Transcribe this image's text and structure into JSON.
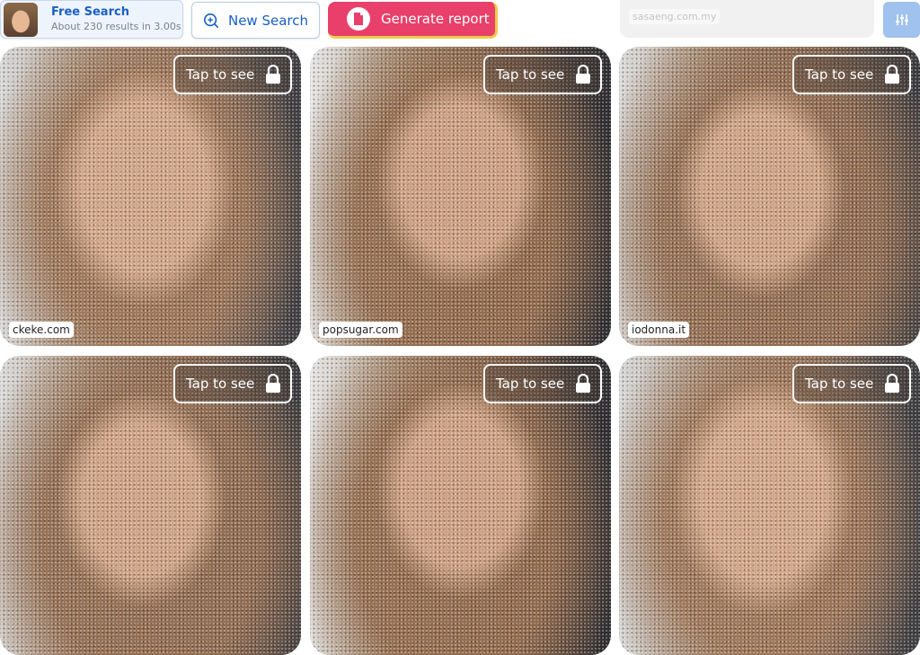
{
  "header": {
    "free_search_title": "Free Search",
    "free_search_subtitle": "About 230 results in 3.00s",
    "new_search_label": "New Search",
    "generate_report_label": "Generate report",
    "top_card_source": "sasaeng.com.my"
  },
  "results": [
    {
      "tap_label": "Tap to see",
      "source": "ckeke.com"
    },
    {
      "tap_label": "Tap to see",
      "source": "popsugar.com"
    },
    {
      "tap_label": "Tap to see",
      "source": "iodonna.it"
    },
    {
      "tap_label": "Tap to see",
      "source": ""
    },
    {
      "tap_label": "Tap to see",
      "source": ""
    },
    {
      "tap_label": "Tap to see",
      "source": ""
    }
  ],
  "colors": {
    "accent_blue": "#1a5fc4",
    "generate_pink": "#e8406a",
    "generate_border": "#f2c94c",
    "filter_button": "#9fc2ee"
  },
  "icons": {
    "new_search": "search-plus-icon",
    "generate_report": "document-icon",
    "filter": "sliders-icon",
    "lock": "lock-icon"
  }
}
